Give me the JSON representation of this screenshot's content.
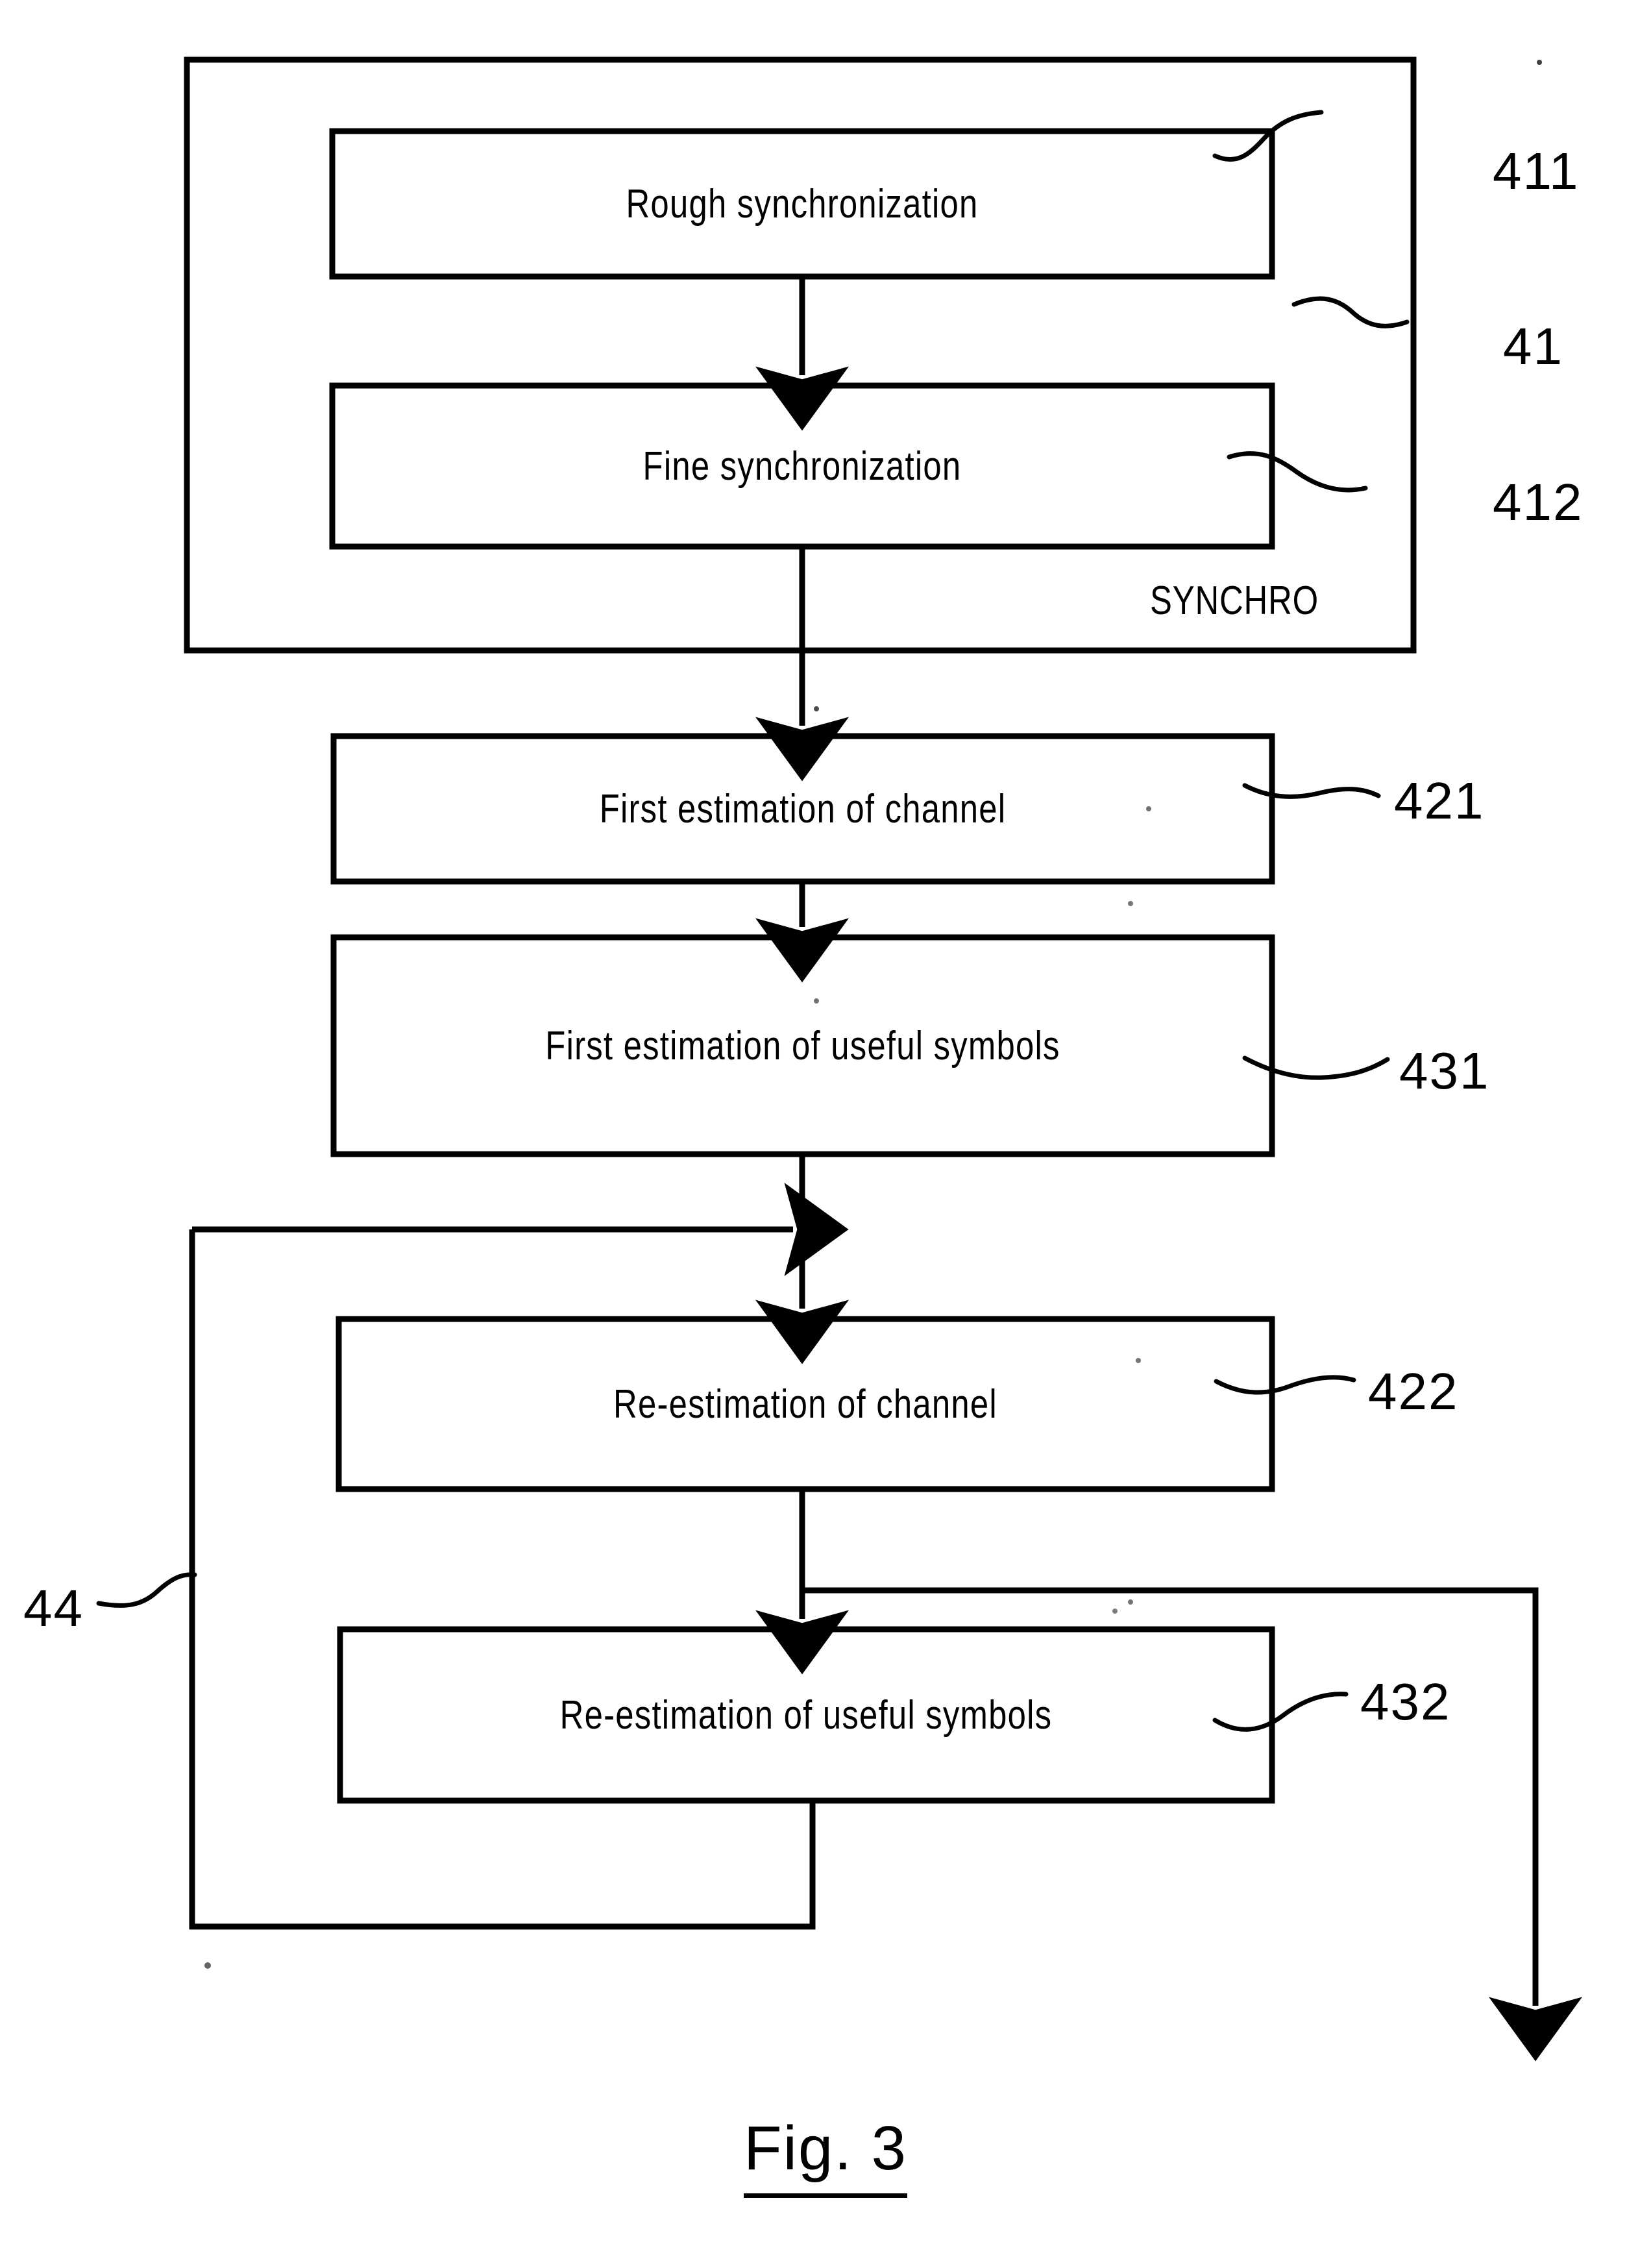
{
  "figure": {
    "caption": "Fig. 3",
    "group_label": "SYNCHRO",
    "group_ref": "41",
    "loop_ref": "44"
  },
  "blocks": [
    {
      "id": "411",
      "label": "Rough  synchronization",
      "ref": "411"
    },
    {
      "id": "412",
      "label": "Fine  synchronization",
      "ref": "412"
    },
    {
      "id": "421",
      "label": "First  estimation  of  channel",
      "ref": "421"
    },
    {
      "id": "431",
      "label": "First  estimation  of  useful  symbols",
      "ref": "431"
    },
    {
      "id": "422",
      "label": "Re-estimation  of  channel",
      "ref": "422"
    },
    {
      "id": "432",
      "label": "Re-estimation  of  useful  symbols",
      "ref": "432"
    }
  ],
  "colors": {
    "ink": "#000000",
    "paper": "#ffffff"
  }
}
